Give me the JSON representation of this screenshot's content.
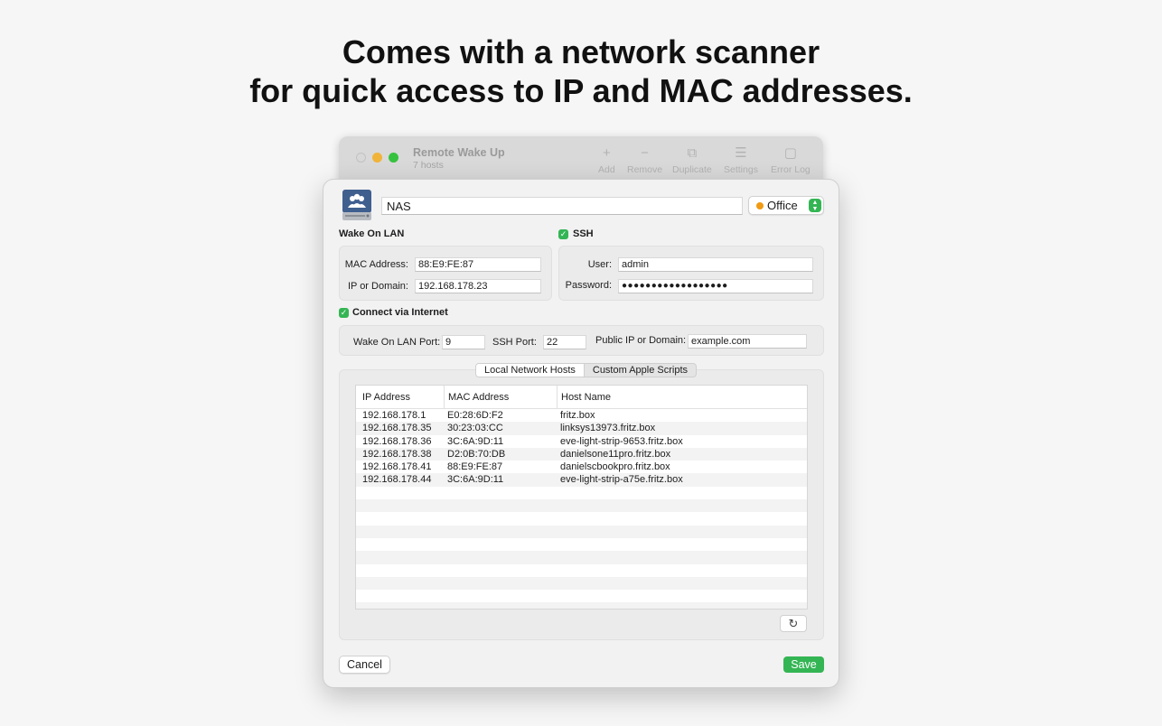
{
  "headline": {
    "line1": "Comes with a network scanner",
    "line2": "for quick access to IP and MAC addresses."
  },
  "background_window": {
    "title": "Remote Wake Up",
    "subtitle": "7 hosts",
    "toolbar": [
      {
        "label": "Add",
        "icon": "plus-icon",
        "glyph": "+"
      },
      {
        "label": "Remove",
        "icon": "minus-icon",
        "glyph": "−"
      },
      {
        "label": "Duplicate",
        "icon": "duplicate-icon",
        "glyph": "⧉"
      },
      {
        "label": "Settings",
        "icon": "settings-icon",
        "glyph": "☰"
      },
      {
        "label": "Error Log",
        "icon": "error-log-icon",
        "glyph": "▢"
      }
    ]
  },
  "host": {
    "name": "NAS",
    "group": "Office",
    "group_color": "#f19a12"
  },
  "wol": {
    "section_label": "Wake On LAN",
    "mac_label": "MAC Address:",
    "mac_value": "88:E9:FE:87",
    "ip_label": "IP or Domain:",
    "ip_value": "192.168.178.23"
  },
  "ssh": {
    "section_label": "SSH",
    "enabled": true,
    "user_label": "User:",
    "user_value": "admin",
    "password_label": "Password:",
    "password_value": "●●●●●●●●●●●●●●●●●●"
  },
  "internet": {
    "section_label": "Connect via Internet",
    "enabled": true,
    "wol_port_label": "Wake On LAN Port:",
    "wol_port_value": "9",
    "ssh_port_label": "SSH Port:",
    "ssh_port_value": "22",
    "public_ip_label": "Public IP or Domain:",
    "public_ip_value": "example.com"
  },
  "tabs": [
    "Local Network Hosts",
    "Custom Apple Scripts"
  ],
  "table": {
    "headers": [
      "IP Address",
      "MAC Address",
      "Host Name"
    ],
    "rows": [
      [
        "192.168.178.1",
        "E0:28:6D:F2",
        "fritz.box"
      ],
      [
        "192.168.178.35",
        "30:23:03:CC",
        "linksys13973.fritz.box"
      ],
      [
        "192.168.178.36",
        "3C:6A:9D:11",
        "eve-light-strip-9653.fritz.box"
      ],
      [
        "192.168.178.38",
        "D2:0B:70:DB",
        "danielsone11pro.fritz.box"
      ],
      [
        "192.168.178.41",
        "88:E9:FE:87",
        "danielscbookpro.fritz.box"
      ],
      [
        "192.168.178.44",
        "3C:6A:9D:11",
        "eve-light-strip-a75e.fritz.box"
      ]
    ]
  },
  "buttons": {
    "cancel": "Cancel",
    "save": "Save",
    "refresh_icon": "refresh-icon"
  },
  "colors": {
    "accent": "#34b554",
    "background": "#f6f6f6"
  }
}
